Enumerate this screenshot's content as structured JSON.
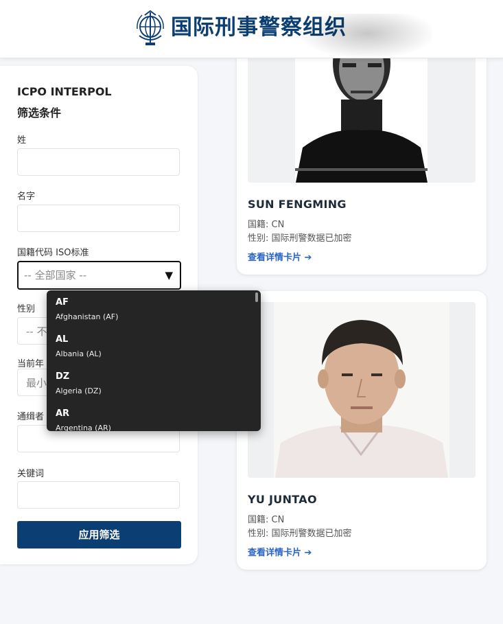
{
  "header": {
    "title": "国际刑事警察组织",
    "logo_icon": "interpol-globe-emblem-icon"
  },
  "filters": {
    "org_label": "ICPO INTERPOL",
    "heading": "筛选条件",
    "surname_label": "姓",
    "surname_value": "",
    "given_name_label": "名字",
    "given_name_value": "",
    "nationality_label": "国籍代码 ISO标准",
    "nationality_selected": "-- 全部国家 --",
    "gender_label": "性别",
    "gender_partial": "-- 不",
    "age_label": "当前年",
    "age_min_placeholder": "最小",
    "issuer_label": "通缉者",
    "keyword_label": "关键词",
    "keyword_value": "",
    "apply_label": "应用筛选"
  },
  "dropdown": {
    "options": [
      {
        "code": "AF",
        "name": "Afghanistan (AF)"
      },
      {
        "code": "AL",
        "name": "Albania (AL)"
      },
      {
        "code": "DZ",
        "name": "Algeria (DZ)"
      },
      {
        "code": "AR",
        "name": "Argentina (AR)"
      }
    ]
  },
  "cards": [
    {
      "name": "SUN FENGMING",
      "nationality": "国籍: CN",
      "gender": "性别: 国际刑警数据已加密",
      "link": "查看详情卡片 ➔"
    },
    {
      "name": "YU JUNTAO",
      "nationality": "国籍: CN",
      "gender": "性别: 国际刑警数据已加密",
      "link": "查看详情卡片 ➔"
    }
  ],
  "colors": {
    "brand": "#0b3e72",
    "link": "#2a64c5",
    "dropdown_bg": "#252525"
  }
}
